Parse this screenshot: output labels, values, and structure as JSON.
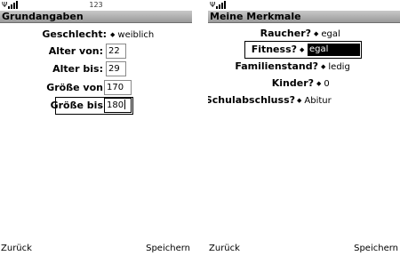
{
  "left": {
    "status_center": "123",
    "title": "Grundangaben",
    "fields": {
      "geschlecht": {
        "label": "Geschlecht:",
        "value": "weiblich"
      },
      "alter_von": {
        "label": "Alter von:",
        "value": "22"
      },
      "alter_bis": {
        "label": "Alter bis:",
        "value": "29"
      },
      "groesse_von": {
        "label": "Größe von",
        "value": "170"
      },
      "groesse_bis": {
        "label": "Größe bis",
        "value": "180"
      }
    },
    "softkeys": {
      "left": "Zurück",
      "right": "Speichern"
    }
  },
  "right": {
    "title": "Meine Merkmale",
    "fields": {
      "raucher": {
        "label": "Raucher?",
        "value": "egal"
      },
      "fitness": {
        "label": "Fitness?",
        "value": "egal"
      },
      "familienstand": {
        "label": "Familienstand?",
        "value": "ledig"
      },
      "kinder": {
        "label": "Kinder?",
        "value": "0"
      },
      "schulabschluss": {
        "label": "Schulabschluss?",
        "value": "Abitur"
      }
    },
    "softkeys": {
      "left": "Zurück",
      "right": "Speichern"
    }
  },
  "icons": {
    "signal": "signal-strength-icon",
    "choice_arrow": "choice-arrow-icon"
  }
}
